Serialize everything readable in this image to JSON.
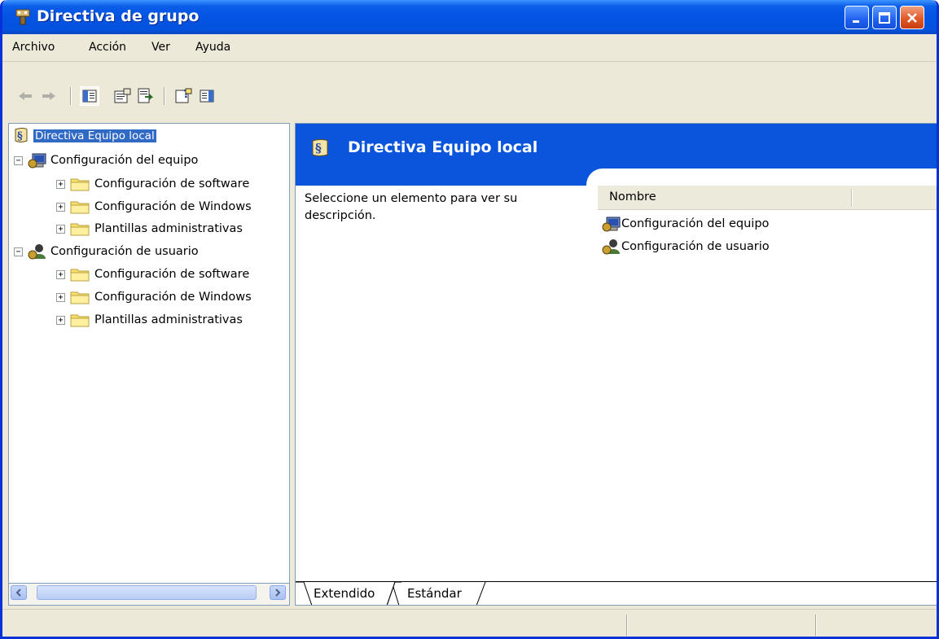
{
  "window": {
    "title": "Directiva de grupo",
    "title_color": "#0553e2"
  },
  "menu": [
    "Archivo",
    "Acción",
    "Ver",
    "Ayuda"
  ],
  "toolbar": {
    "icons": [
      "back-arrow-icon",
      "forward-arrow-icon",
      "show-hide-tree-icon",
      "properties-icon",
      "export-list-icon",
      "help-icon",
      "show-hide-action-pane-icon"
    ]
  },
  "tree": {
    "root": "Directiva Equipo local",
    "computer": "Configuración del equipo",
    "computer_children": [
      "Configuración de software",
      "Configuración de Windows",
      "Plantillas administrativas"
    ],
    "user": "Configuración de usuario",
    "user_children": [
      "Configuración de software",
      "Configuración de Windows",
      "Plantillas administrativas"
    ],
    "selected_color": "#316ac5"
  },
  "right_pane": {
    "banner_title": "Directiva Equipo local",
    "banner_color": "#0a55dc",
    "description": "Seleccione un elemento para ver su descripción.",
    "column_header": "Nombre",
    "items": [
      "Configuración del equipo",
      "Configuración de usuario"
    ]
  },
  "tabs": [
    "Extendido",
    "Estándar"
  ]
}
